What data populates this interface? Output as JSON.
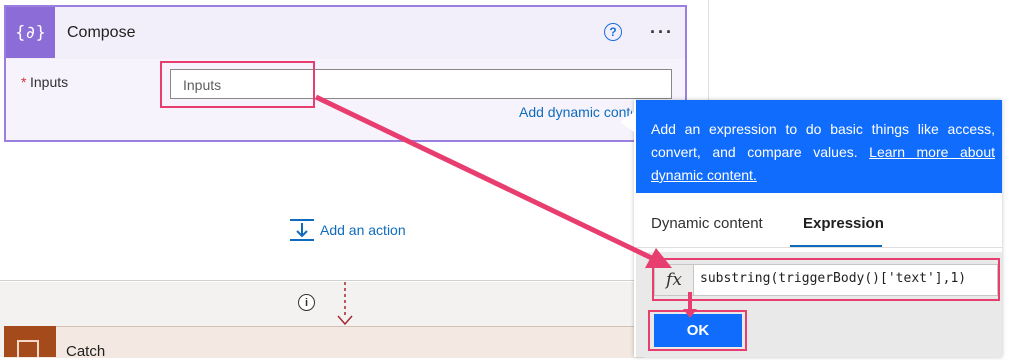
{
  "compose": {
    "title": "Compose",
    "icon_glyph": "{∂}",
    "help_glyph": "?",
    "more_glyph": "···",
    "required_marker": "*",
    "inputs_label": "Inputs",
    "inputs_placeholder": "Inputs",
    "dynamic_link": "Add dynamic content"
  },
  "add_action": {
    "label": "Add an action"
  },
  "info_glyph": "i",
  "catch": {
    "title": "Catch"
  },
  "expression_panel": {
    "description": "Add an expression to do basic things like access, convert, and compare values.",
    "learn_more": "Learn more about dynamic content.",
    "tabs": [
      "Dynamic content",
      "Expression"
    ],
    "active_tab": "Expression",
    "fx_glyph": "fx",
    "expression_value": "substring(triggerBody()['text'],1)",
    "ok_label": "OK"
  },
  "colors": {
    "compose_accent": "#8c6cd7",
    "link_blue": "#0f6cbd",
    "panel_blue": "#0f6cfd",
    "highlight_pink": "#e83e6f",
    "catch_brown": "#a54a1b"
  }
}
